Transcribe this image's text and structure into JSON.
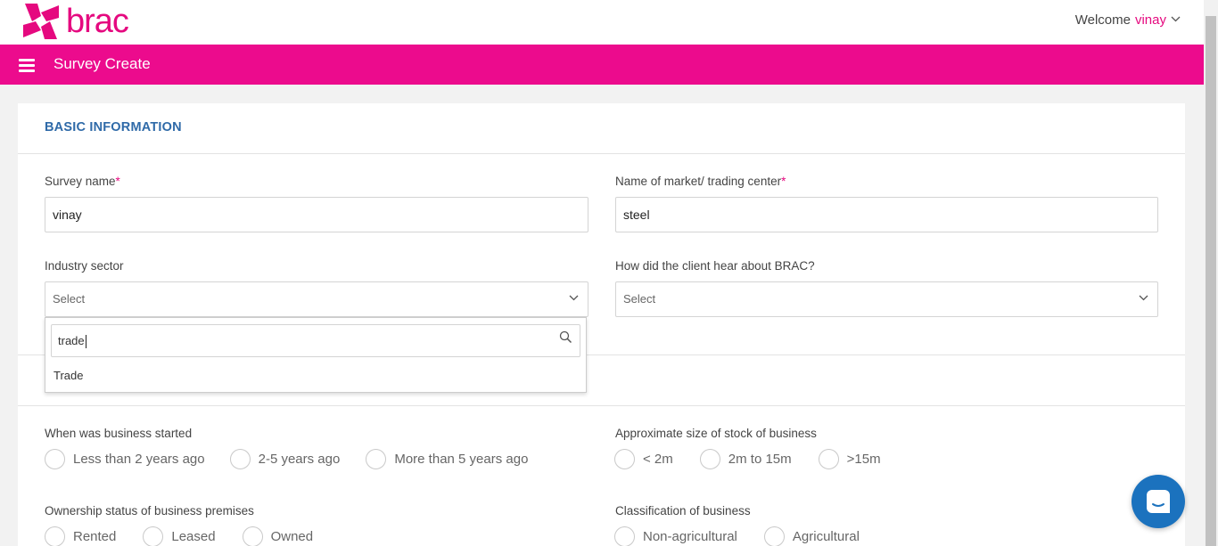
{
  "header": {
    "logo_text": "brac",
    "welcome_label": "Welcome",
    "user_name": "vinay",
    "page_title": "Survey Create"
  },
  "basic_info": {
    "title": "BASIC INFORMATION",
    "survey_name": {
      "label": "Survey name",
      "required_mark": "*",
      "value": "vinay"
    },
    "market_name": {
      "label": "Name of market/ trading center",
      "required_mark": "*",
      "value": "steel"
    },
    "industry_sector": {
      "label": "Industry sector",
      "placeholder": "Select"
    },
    "hear_about": {
      "label": "How did the client hear about BRAC?",
      "placeholder": "Select"
    }
  },
  "industry_dropdown": {
    "search_value": "trade",
    "options": [
      "Trade"
    ]
  },
  "business": {
    "started": {
      "label": "When was business started",
      "options": [
        "Less than 2 years ago",
        "2-5 years ago",
        "More than 5 years ago"
      ]
    },
    "stock_size": {
      "label": "Approximate size of stock of business",
      "options": [
        "< 2m",
        "2m to 15m",
        ">15m"
      ]
    },
    "ownership": {
      "label": "Ownership status of business premises",
      "options": [
        "Rented",
        "Leased",
        "Owned"
      ]
    },
    "classification": {
      "label": "Classification of business",
      "options": [
        "Non-agricultural",
        "Agricultural"
      ]
    }
  },
  "colors": {
    "brand_pink": "#ec0b8d",
    "section_blue": "#2f6aa8",
    "chat_blue": "#1b72be"
  }
}
